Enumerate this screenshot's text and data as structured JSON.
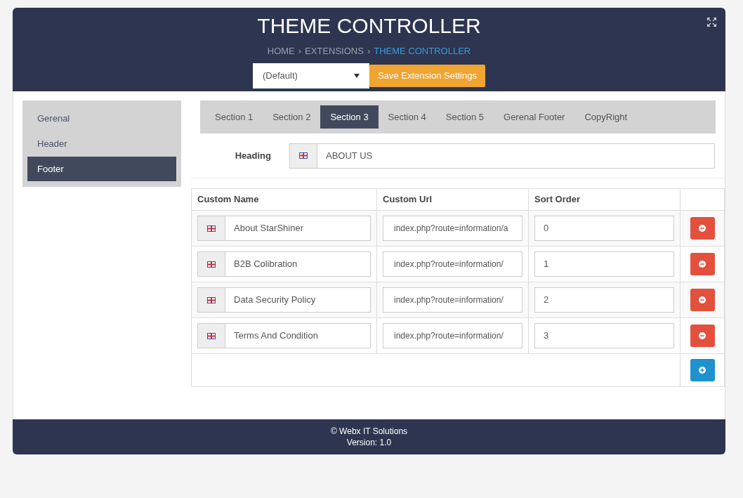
{
  "header": {
    "title": "THEME CONTROLLER",
    "breadcrumb": [
      {
        "label": "HOME",
        "current": false
      },
      {
        "sep": "›",
        "label": "EXTENSIONS",
        "current": false
      },
      {
        "sep": "›",
        "label": "THEME CONTROLLER",
        "current": true
      }
    ],
    "theme_select": {
      "value": "(Default)"
    },
    "save_button": "Save Extension Settings"
  },
  "sidebar": {
    "items": [
      {
        "label": "Gerenal",
        "selected": false
      },
      {
        "label": "Header",
        "selected": false
      },
      {
        "label": "Footer",
        "selected": true
      }
    ]
  },
  "tabs": [
    {
      "label": "Section 1",
      "selected": false
    },
    {
      "label": "Section 2",
      "selected": false
    },
    {
      "label": "Section 3",
      "selected": true
    },
    {
      "label": "Section 4",
      "selected": false
    },
    {
      "label": "Section 5",
      "selected": false
    },
    {
      "label": "Gerenal Footer",
      "selected": false
    },
    {
      "label": "CopyRight",
      "selected": false
    }
  ],
  "heading": {
    "label": "Heading",
    "value": "ABOUT US"
  },
  "table": {
    "columns": [
      "Custom Name",
      "Custom Url",
      "Sort Order"
    ],
    "rows": [
      {
        "name": "About StarShiner",
        "url": "index.php?route=information/a",
        "sort": "0"
      },
      {
        "name": "B2B Colibration",
        "url": "index.php?route=information/",
        "sort": "1"
      },
      {
        "name": "Data Security Policy",
        "url": "index.php?route=information/",
        "sort": "2"
      },
      {
        "name": "Terms And Condition",
        "url": "index.php?route=information/",
        "sort": "3"
      }
    ]
  },
  "footer": {
    "lines": [
      "© Webx IT Solutions",
      "Version: 1.0"
    ]
  }
}
